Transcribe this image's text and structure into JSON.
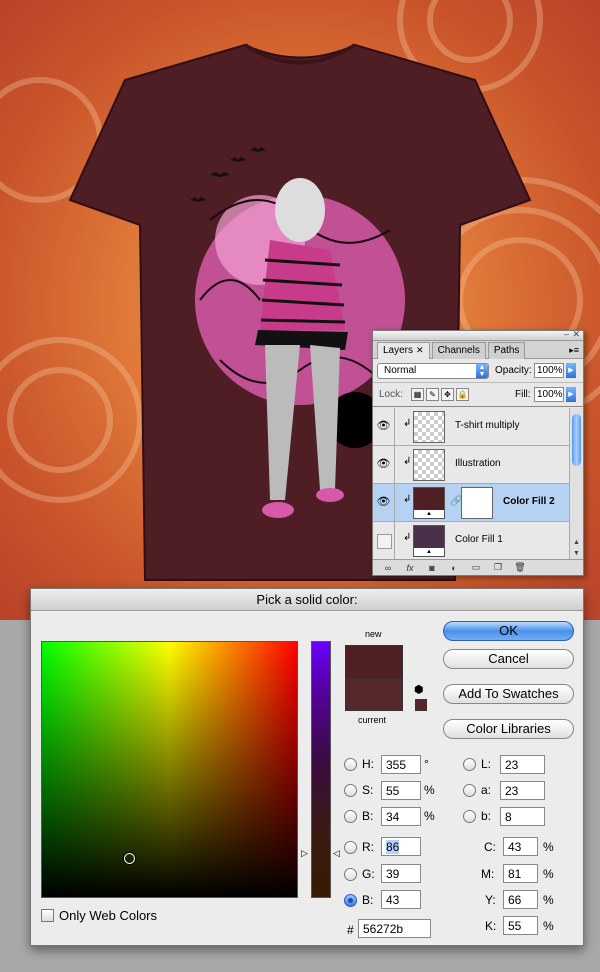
{
  "layers_panel": {
    "tabs": [
      "Layers",
      "Channels",
      "Paths"
    ],
    "tab_close": "✕",
    "blend_mode": "Normal",
    "opacity_label": "Opacity:",
    "opacity_value": "100%",
    "lock_label": "Lock:",
    "fill_label": "Fill:",
    "fill_value": "100%",
    "layers": [
      {
        "name": "T-shirt multiply",
        "visible": true
      },
      {
        "name": "Illustration",
        "visible": true
      },
      {
        "name": "Color Fill 2",
        "visible": true,
        "selected": true,
        "fill_color": "#4f1f24"
      },
      {
        "name": "Color Fill 1",
        "visible": false,
        "fill_color": "#4a3048"
      }
    ]
  },
  "picker": {
    "title": "Pick a solid color:",
    "new_label": "new",
    "current_label": "current",
    "new_color": "#4f1f24",
    "current_color": "#56272b",
    "buttons": {
      "ok": "OK",
      "cancel": "Cancel",
      "add_swatches": "Add To Swatches",
      "libraries": "Color Libraries"
    },
    "hsb": {
      "h_label": "H:",
      "h": "355",
      "h_unit": "°",
      "s_label": "S:",
      "s": "55",
      "s_unit": "%",
      "b_label": "B:",
      "b": "34",
      "b_unit": "%"
    },
    "rgb": {
      "r_label": "R:",
      "r": "86",
      "g_label": "G:",
      "g": "39",
      "b_label": "B:",
      "b": "43"
    },
    "hex_label": "#",
    "hex": "56272b",
    "lab": {
      "l_label": "L:",
      "l": "23",
      "a_label": "a:",
      "a": "23",
      "b_label": "b:",
      "b": "8"
    },
    "cmyk": {
      "c_label": "C:",
      "c": "43",
      "m_label": "M:",
      "m": "81",
      "y_label": "Y:",
      "y": "66",
      "k_label": "K:",
      "k": "55",
      "unit": "%"
    },
    "web_only_label": "Only Web Colors"
  }
}
